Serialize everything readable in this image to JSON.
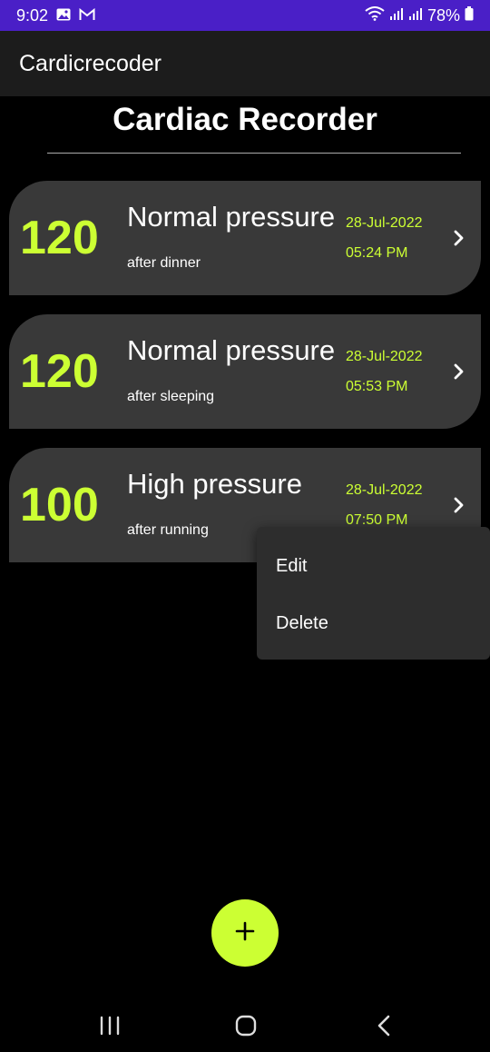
{
  "status_bar": {
    "time": "9:02",
    "battery": "78%",
    "icons": [
      "gallery-icon",
      "gmail-icon",
      "wifi-icon",
      "signal-icon",
      "signal-icon",
      "battery-icon"
    ]
  },
  "app_bar": {
    "title": "Cardicrecoder"
  },
  "page": {
    "title": "Cardiac Recorder"
  },
  "records": [
    {
      "bpm": "120",
      "status": "Normal pressure",
      "note": "after dinner",
      "date": "28-Jul-2022",
      "time": "05:24 PM"
    },
    {
      "bpm": "120",
      "status": "Normal pressure",
      "note": "after sleeping",
      "date": "28-Jul-2022",
      "time": "05:53 PM"
    },
    {
      "bpm": "100",
      "status": "High pressure",
      "note": "after running",
      "date": "28-Jul-2022",
      "time": "07:50 PM"
    }
  ],
  "context_menu": {
    "items": [
      "Edit",
      "Delete"
    ]
  },
  "fab": {
    "icon": "plus-icon"
  },
  "nav_bar": {
    "icons": [
      "recent-apps-icon",
      "home-icon",
      "back-icon"
    ]
  },
  "colors": {
    "status_bar": "#4a1fc7",
    "app_bar": "#1c1c1c",
    "card": "#393939",
    "accent": "#ccff33",
    "menu": "#2d2d2d"
  }
}
